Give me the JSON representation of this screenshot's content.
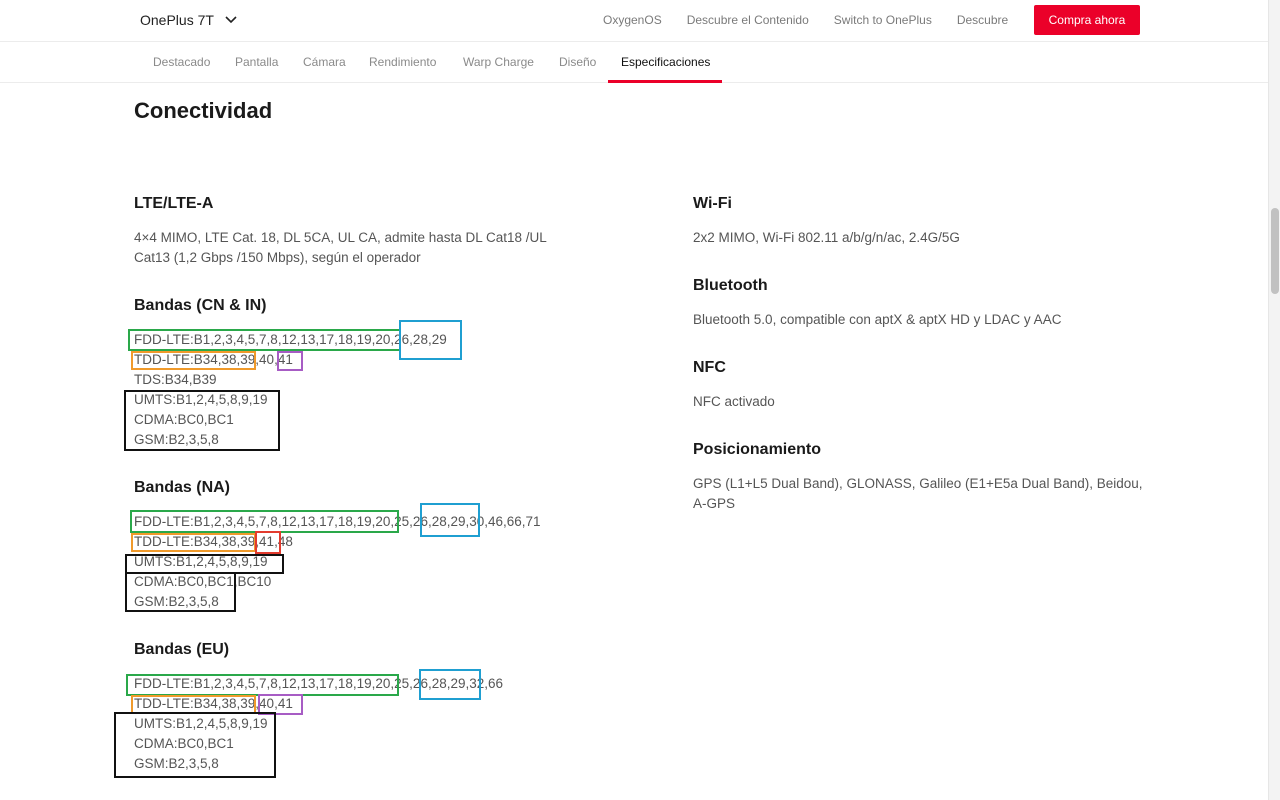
{
  "header": {
    "product": "OnePlus 7T",
    "links": [
      "OxygenOS",
      "Descubre el Contenido",
      "Switch to OnePlus",
      "Descubre"
    ],
    "buy_label": "Compra ahora",
    "accent": "#eb0029"
  },
  "subnav": {
    "tabs": [
      "Destacado",
      "Pantalla",
      "Cámara",
      "Rendimiento",
      "Warp Charge",
      "Diseño",
      "Especificaciones"
    ],
    "active": "Especificaciones"
  },
  "section": {
    "title": "Conectividad"
  },
  "left": {
    "lte_title": "LTE/LTE-A",
    "lte_desc_1": "4×4 MIMO, LTE Cat. 18, DL 5CA, UL CA, admite hasta DL Cat18 /UL",
    "lte_desc_2": "Cat13 (1,2 Gbps /150 Mbps), según el operador",
    "cn_title": "Bandas (CN & IN)",
    "cn_lines": [
      "FDD-LTE:B1,2,3,4,5,7,8,12,13,17,18,19,20,26,28,29",
      "TDD-LTE:B34,38,39,40,41",
      "TDS:B34,B39",
      "UMTS:B1,2,4,5,8,9,19",
      "CDMA:BC0,BC1",
      "GSM:B2,3,5,8"
    ],
    "na_title": "Bandas (NA)",
    "na_lines": [
      "FDD-LTE:B1,2,3,4,5,7,8,12,13,17,18,19,20,25,26,28,29,30,46,66,71",
      "TDD-LTE:B34,38,39,41,48",
      "UMTS:B1,2,4,5,8,9,19",
      "CDMA:BC0,BC1,BC10",
      "GSM:B2,3,5,8"
    ],
    "eu_title": "Bandas (EU)",
    "eu_lines": [
      "FDD-LTE:B1,2,3,4,5,7,8,12,13,17,18,19,20,25,26,28,29,32,66",
      "TDD-LTE:B34,38,39,40,41",
      "UMTS:B1,2,4,5,8,9,19",
      "CDMA:BC0,BC1",
      "GSM:B2,3,5,8"
    ]
  },
  "right": {
    "wifi_title": "Wi-Fi",
    "wifi_desc": "2x2 MIMO, Wi-Fi 802.11 a/b/g/n/ac, 2.4G/5G",
    "bt_title": "Bluetooth",
    "bt_desc": "Bluetooth 5.0, compatible con aptX & aptX HD y LDAC y AAC",
    "nfc_title": "NFC",
    "nfc_desc": "NFC activado",
    "pos_title": "Posicionamiento",
    "pos_desc_1": "GPS (L1+L5 Dual Band), GLONASS, Galileo (E1+E5a Dual Band), Beidou,",
    "pos_desc_2": "A-GPS"
  },
  "annotation_colors": {
    "green": "#2aa84a",
    "blue": "#1f9fd1",
    "orange": "#f09a2b",
    "purple": "#a75cc4",
    "black": "#111111",
    "red": "#e23b2e"
  }
}
